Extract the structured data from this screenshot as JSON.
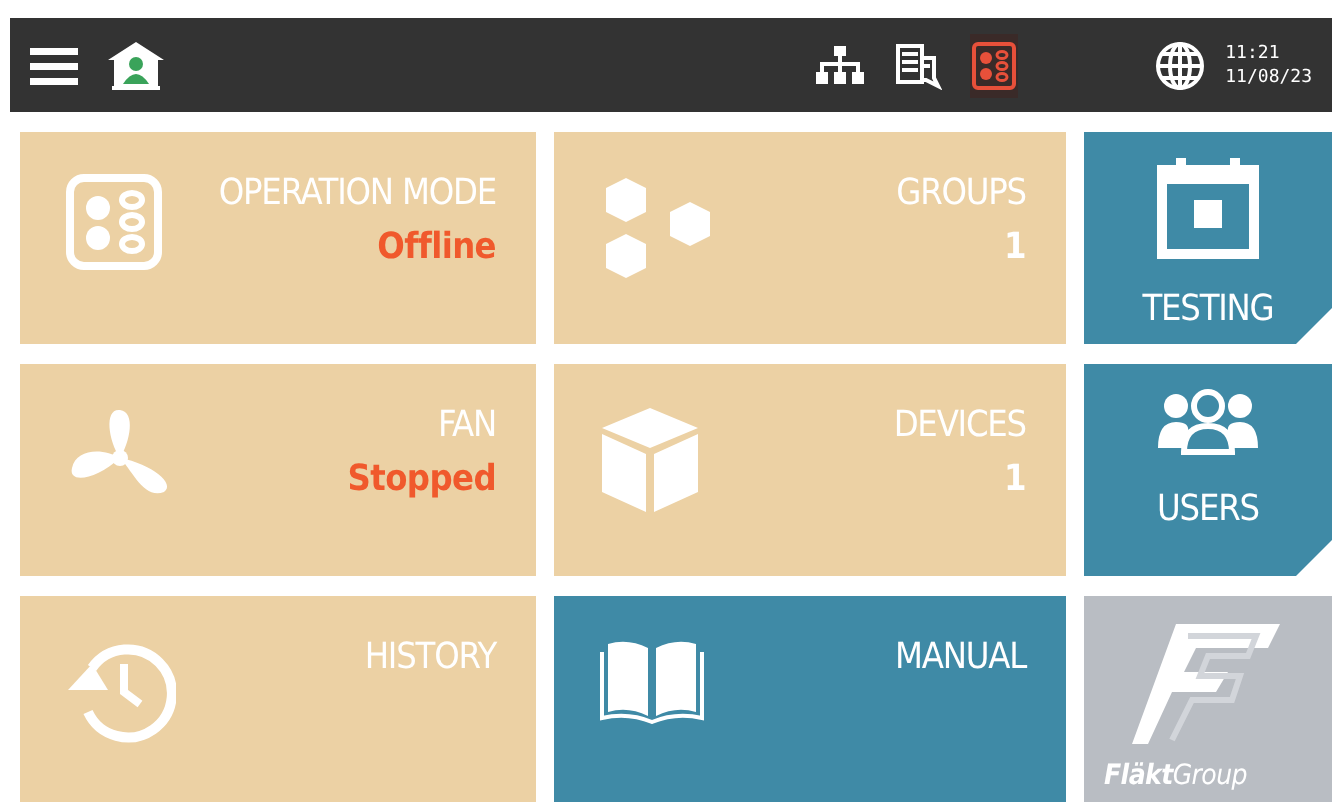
{
  "top_bar": {
    "icons": [
      {
        "kind": "menu",
        "active": false
      },
      {
        "kind": "home",
        "active": false
      },
      {
        "kind": "network",
        "active": false
      },
      {
        "kind": "log",
        "active": false
      },
      {
        "kind": "mode",
        "active": true
      },
      {
        "kind": "globe",
        "active": false
      }
    ],
    "time": "11:21",
    "date": "11/08/23"
  },
  "tiles": [
    {
      "kind": "wide",
      "color": "#ecd1a4",
      "label": "OPERATION MODE",
      "value": {
        "text": "Offline",
        "alert": true
      }
    },
    {
      "kind": "wide",
      "color": "#ecd1a4",
      "label": "GROUPS",
      "value": {
        "text": "1",
        "alert": false
      }
    },
    {
      "kind": "side",
      "color": "#3f8aa6",
      "label": "TESTING"
    },
    {
      "kind": "wide",
      "color": "#ecd1a4",
      "label": "FAN",
      "value": {
        "text": "Stopped",
        "alert": true
      }
    },
    {
      "kind": "wide",
      "color": "#ecd1a4",
      "label": "DEVICES",
      "value": {
        "text": "1",
        "alert": false
      }
    },
    {
      "kind": "side",
      "color": "#3f8aa6",
      "label": "USERS"
    },
    {
      "kind": "wide",
      "color": "#ecd1a4",
      "label": "HISTORY"
    },
    {
      "kind": "wide",
      "color": "#3f8aa6",
      "label": "MANUAL"
    },
    {
      "kind": "logo",
      "color": "#b9bdc3",
      "label": "**Fläkt**Group"
    }
  ]
}
